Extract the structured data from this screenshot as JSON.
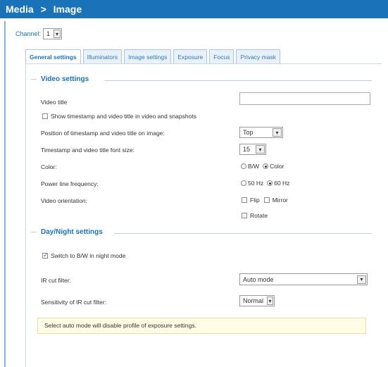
{
  "header": {
    "section": "Media",
    "separator": ">",
    "page": "Image"
  },
  "channel": {
    "label": "Channel:",
    "value": "1"
  },
  "tabs": [
    {
      "label": "General settings",
      "active": true
    },
    {
      "label": "Illuminators",
      "active": false
    },
    {
      "label": "Image settings",
      "active": false
    },
    {
      "label": "Exposure",
      "active": false
    },
    {
      "label": "Focus",
      "active": false
    },
    {
      "label": "Privacy mask",
      "active": false
    }
  ],
  "video_settings": {
    "heading": "Video settings",
    "video_title_label": "Video title",
    "video_title_value": "",
    "show_timestamp_label": "Show timestamp and video title in video and snapshots",
    "show_timestamp_checked": false,
    "position_label": "Position of timestamp and video title on image:",
    "position_value": "Top",
    "font_size_label": "Timestamp and video title font size:",
    "font_size_value": "15",
    "color_label": "Color:",
    "color_options": [
      "B/W",
      "Color"
    ],
    "color_selected": "Color",
    "power_line_label": "Power line frequency:",
    "power_line_options": [
      "50 Hz",
      "60 Hz"
    ],
    "power_line_selected": "60 Hz",
    "orientation_label": "Video orientation:",
    "flip_label": "Flip",
    "mirror_label": "Mirror",
    "rotate_label": "Rotate"
  },
  "day_night": {
    "heading": "Day/Night settings",
    "switch_bw_label": "Switch to B/W in night mode",
    "switch_bw_checked": true,
    "ir_cut_label": "IR cut filter:",
    "ir_cut_value": "Auto mode",
    "sensitivity_label": "Sensitivity of IR cut filter:",
    "sensitivity_value": "Normal",
    "notice": "Select auto mode will disable profile of exposure settings."
  },
  "colors": {
    "brand": "#1a73b9",
    "notice_bg": "#fffde6"
  }
}
